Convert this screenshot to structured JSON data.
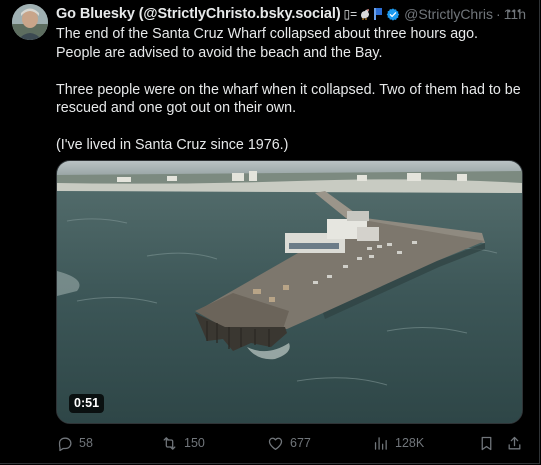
{
  "post": {
    "author": {
      "display_name": "Go Bluesky (@StrictlyChristo.bsky.social)",
      "name_suffix": "▯=",
      "handle": "@StrictlyChris",
      "separator": "·",
      "time": "11h"
    },
    "text": {
      "paragraph1": "The end of the Santa Cruz Wharf collapsed about three hours ago. People are advised to avoid the beach and the Bay.",
      "paragraph2": "Three people were on the wharf when it collapsed. Two of them had to be rescued and one got out on their own.",
      "paragraph3": "(I've lived in Santa Cruz since 1976.)"
    },
    "media": {
      "type": "video",
      "duration": "0:51"
    },
    "stats": {
      "replies": "58",
      "reposts": "150",
      "likes": "677",
      "views": "128K"
    }
  },
  "icons": {
    "more": "more-icon",
    "verified": "verified-badge-icon",
    "reply": "reply-icon",
    "repost": "repost-icon",
    "like": "heart-icon",
    "views": "views-icon",
    "bookmark": "bookmark-icon",
    "share": "share-icon"
  },
  "colors": {
    "background": "#000000",
    "text_primary": "#e7e9ea",
    "text_secondary": "#71767b",
    "verified": "#1d9bf0",
    "border": "#2f3336"
  }
}
